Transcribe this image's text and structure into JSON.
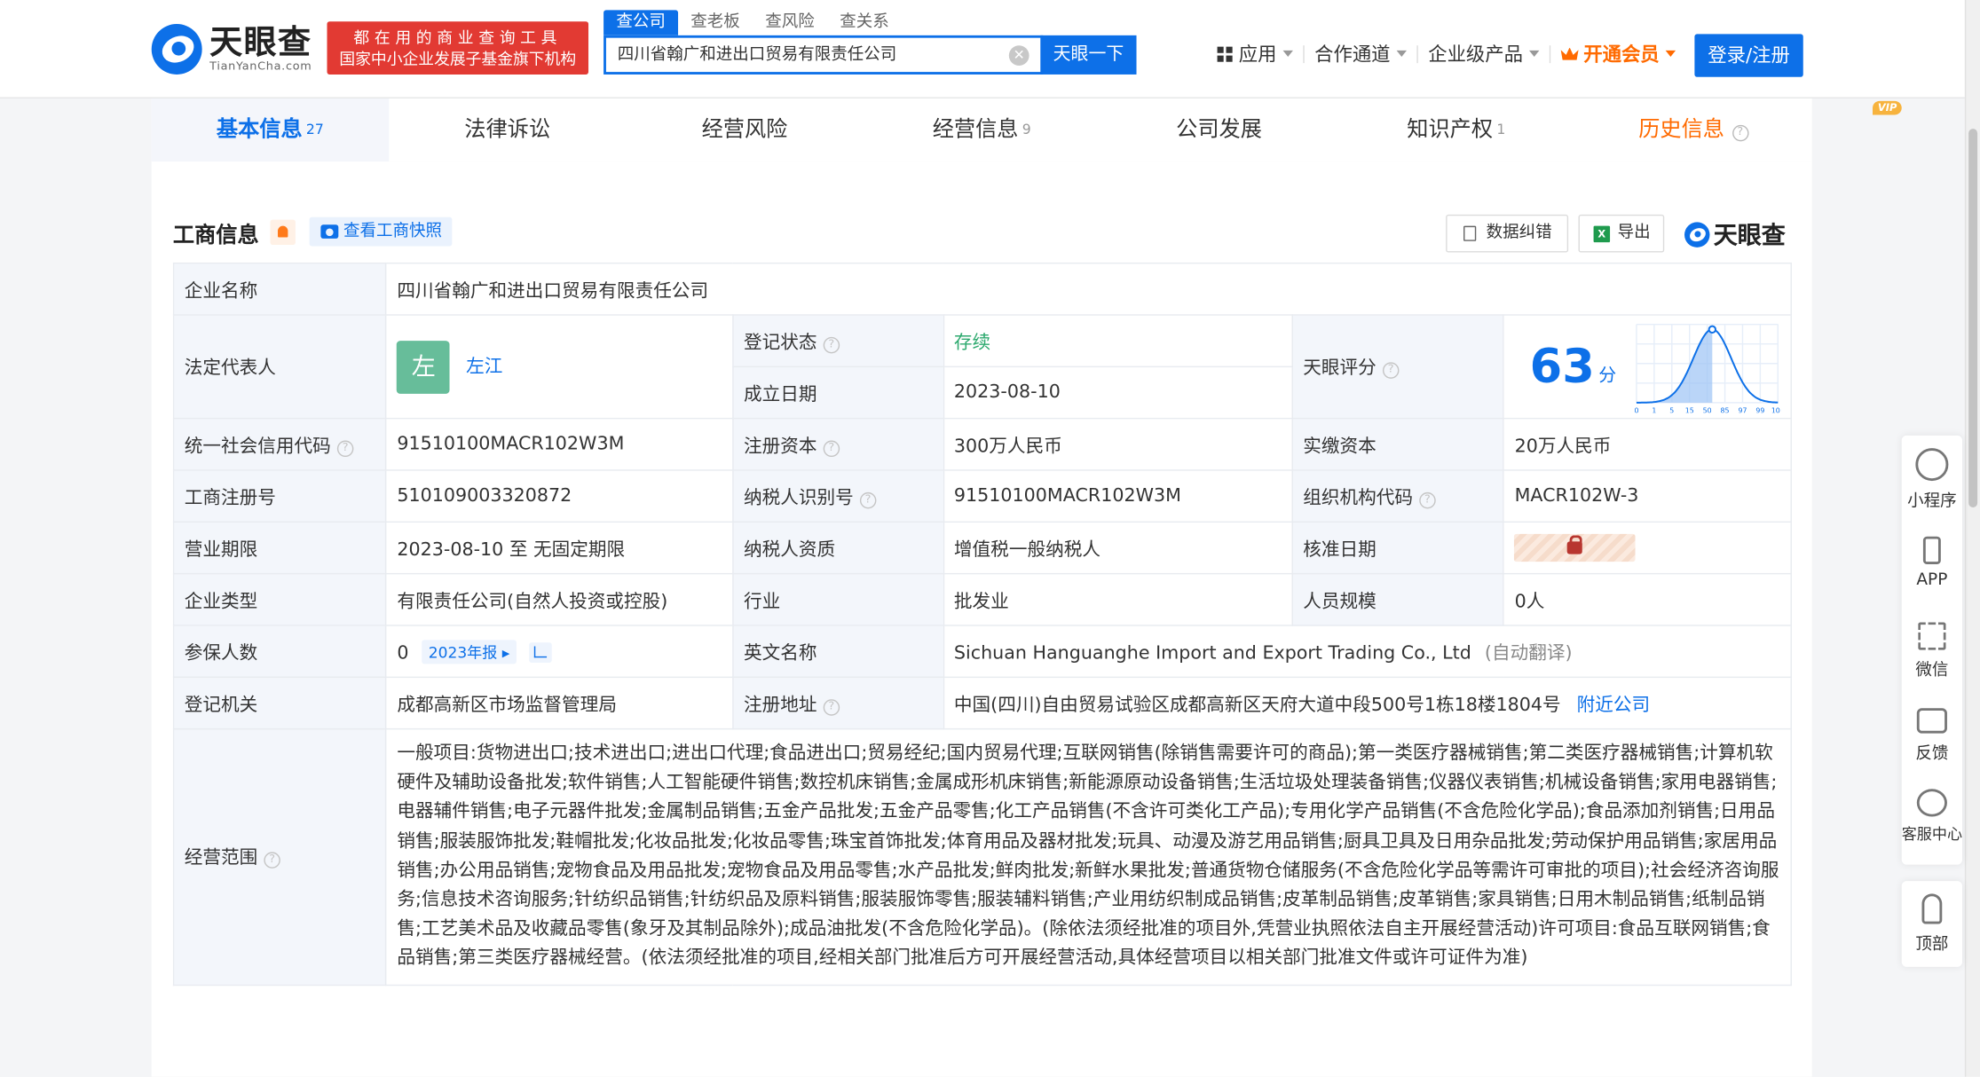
{
  "header": {
    "logo_main": "天眼查",
    "logo_sub": "TianYanCha.com",
    "banner_line1": "都在用的商业查询工具",
    "banner_line2": "国家中小企业发展子基金旗下机构",
    "search_tabs": [
      "查公司",
      "查老板",
      "查风险",
      "查关系"
    ],
    "search_value": "四川省翰广和进出口贸易有限责任公司",
    "search_button": "天眼一下",
    "nav": [
      "应用",
      "合作通道",
      "企业级产品",
      "开通会员"
    ],
    "login": "登录/注册"
  },
  "tabs": [
    {
      "label": "基本信息",
      "count": "27"
    },
    {
      "label": "法律诉讼",
      "count": ""
    },
    {
      "label": "经营风险",
      "count": ""
    },
    {
      "label": "经营信息",
      "count": "9"
    },
    {
      "label": "公司发展",
      "count": ""
    },
    {
      "label": "知识产权",
      "count": "1"
    },
    {
      "label": "历史信息",
      "count": "",
      "badge": "VIP"
    }
  ],
  "section": {
    "title": "工商信息",
    "snapshot_button": "查看工商快照",
    "correct_button": "数据纠错",
    "export_button": "导出",
    "brand": "天眼查"
  },
  "info": {
    "company_name_label": "企业名称",
    "company_name": "四川省翰广和进出口贸易有限责任公司",
    "legal_rep_label": "法定代表人",
    "legal_rep_avatar": "左",
    "legal_rep": "左江",
    "reg_status_label": "登记状态",
    "reg_status": "存续",
    "found_date_label": "成立日期",
    "found_date": "2023-08-10",
    "score_label": "天眼评分",
    "score": "63",
    "score_unit": "分",
    "credit_code_label": "统一社会信用代码",
    "credit_code": "91510100MACR102W3M",
    "reg_capital_label": "注册资本",
    "reg_capital": "300万人民币",
    "paid_capital_label": "实缴资本",
    "paid_capital": "20万人民币",
    "biz_reg_no_label": "工商注册号",
    "biz_reg_no": "510109003320872",
    "taxpayer_id_label": "纳税人识别号",
    "taxpayer_id": "91510100MACR102W3M",
    "org_code_label": "组织机构代码",
    "org_code": "MACR102W-3",
    "term_label": "营业期限",
    "term": "2023-08-10 至 无固定期限",
    "taxpayer_qual_label": "纳税人资质",
    "taxpayer_qual": "增值税一般纳税人",
    "approve_date_label": "核准日期",
    "type_label": "企业类型",
    "type": "有限责任公司(自然人投资或控股)",
    "industry_label": "行业",
    "industry": "批发业",
    "staff_label": "人员规模",
    "staff": "0人",
    "insured_label": "参保人数",
    "insured": "0",
    "insured_report": "2023年报",
    "en_name_label": "英文名称",
    "en_name": "Sichuan Hanguanghe Import and Export Trading Co., Ltd",
    "en_name_note": "(自动翻译)",
    "authority_label": "登记机关",
    "authority": "成都高新区市场监督管理局",
    "address_label": "注册地址",
    "address": "中国(四川)自由贸易试验区成都高新区天府大道中段500号1栋18楼1804号",
    "nearby": "附近公司",
    "scope_label": "经营范围",
    "scope": "一般项目:货物进出口;技术进出口;进出口代理;食品进出口;贸易经纪;国内贸易代理;互联网销售(除销售需要许可的商品);第一类医疗器械销售;第二类医疗器械销售;计算机软硬件及辅助设备批发;软件销售;人工智能硬件销售;数控机床销售;金属成形机床销售;新能源原动设备销售;生活垃圾处理装备销售;仪器仪表销售;机械设备销售;家用电器销售;电器辅件销售;电子元器件批发;金属制品销售;五金产品批发;五金产品零售;化工产品销售(不含许可类化工产品);专用化学产品销售(不含危险化学品);食品添加剂销售;日用品销售;服装服饰批发;鞋帽批发;化妆品批发;化妆品零售;珠宝首饰批发;体育用品及器材批发;玩具、动漫及游艺用品销售;厨具卫具及日用杂品批发;劳动保护用品销售;家居用品销售;办公用品销售;宠物食品及用品批发;宠物食品及用品零售;水产品批发;鲜肉批发;新鲜水果批发;普通货物仓储服务(不含危险化学品等需许可审批的项目);社会经济咨询服务;信息技术咨询服务;针纺织品销售;针纺织品及原料销售;服装服饰零售;服装辅料销售;产业用纺织制成品销售;皮革制品销售;皮革销售;家具销售;日用木制品销售;纸制品销售;工艺美术品及收藏品零售(象牙及其制品除外);成品油批发(不含危险化学品)。(除依法须经批准的项目外,凭营业执照依法自主开展经营活动)许可项目:食品互联网销售;食品销售;第三类医疗器械经营。(依法须经批准的项目,经相关部门批准后方可开展经营活动,具体经营项目以相关部门批准文件或许可证件为准)"
  },
  "score_chart": {
    "x_ticks": [
      "0",
      "1",
      "5",
      "15",
      "50",
      "85",
      "97",
      "99",
      "100"
    ],
    "highlight": 63
  },
  "side": [
    "小程序",
    "APP",
    "微信",
    "反馈",
    "客服中心"
  ],
  "side_top": "顶部",
  "colors": {
    "brand": "#0d70e8",
    "vip": "#ff6a00",
    "status": "#2eaa6f"
  }
}
